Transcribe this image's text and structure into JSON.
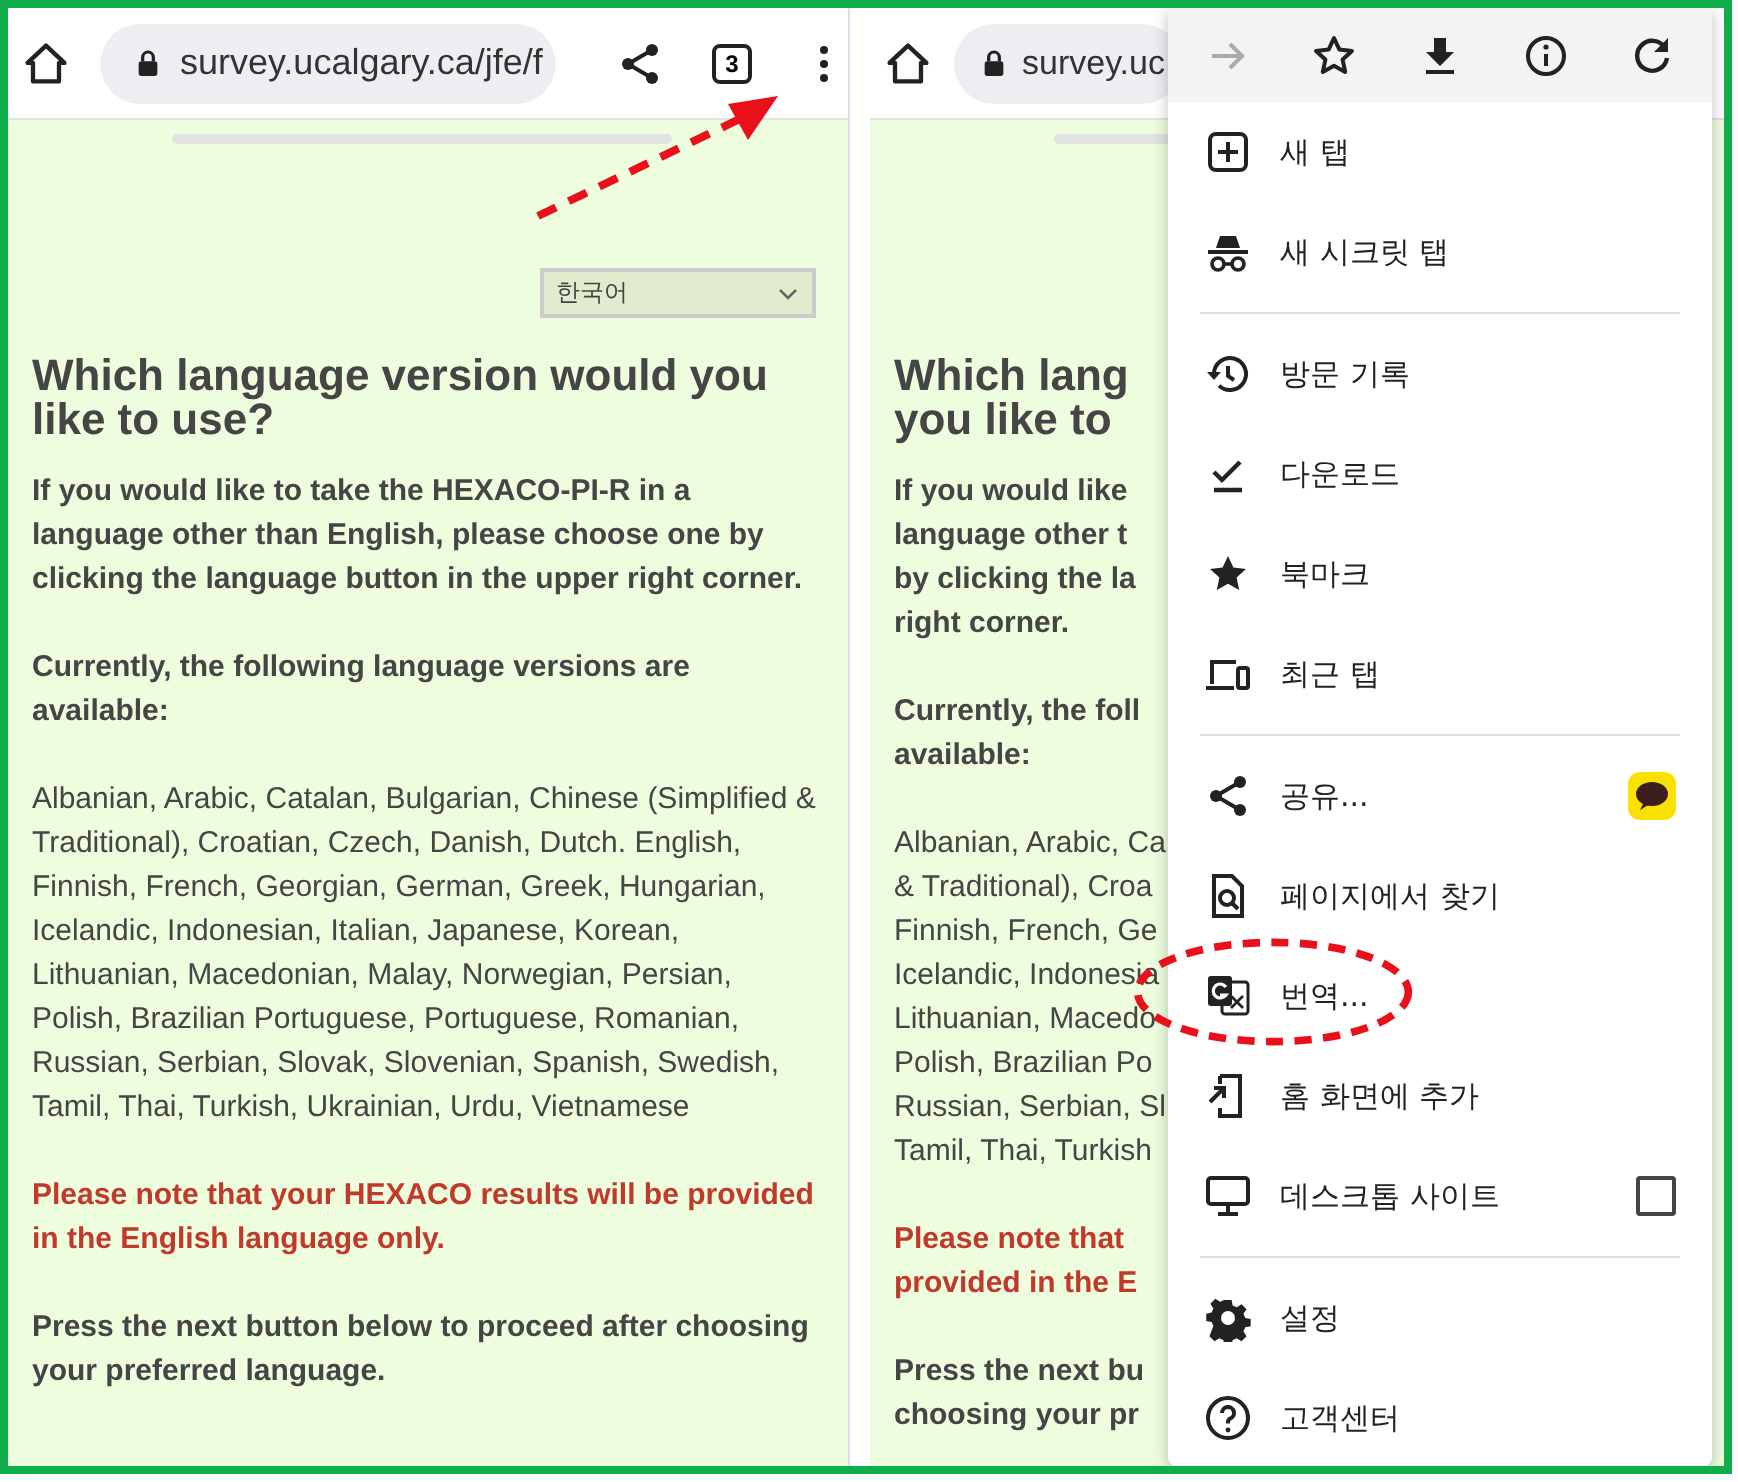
{
  "left_screen": {
    "toolbar": {
      "url": "survey.ucalgary.ca/jfe/f",
      "tab_count": "3"
    },
    "page": {
      "language_select": {
        "value": "한국어"
      },
      "heading": "Which language version would you like to use?",
      "paragraphs": [
        {
          "kind": "bold",
          "text": "If you would like to take the HEXACO-PI-R in a language other than English, please choose one by clicking the language button in the upper right corner."
        },
        {
          "kind": "bold",
          "text": "Currently, the following language versions are available:"
        },
        {
          "kind": "plain",
          "text": "Albanian, Arabic, Catalan, Bulgarian, Chinese (Simplified & Traditional), Croatian, Czech, Danish, Dutch. English, Finnish, French, Georgian, German, Greek, Hungarian, Icelandic, Indonesian, Italian, Japanese, Korean, Lithuanian, Macedonian, Malay, Norwegian, Persian, Polish, Brazilian Portuguese, Portuguese, Romanian, Russian, Serbian, Slovak, Slovenian, Spanish, Swedish, Tamil, Thai, Turkish, Ukrainian, Urdu, Vietnamese"
        },
        {
          "kind": "warning",
          "text": "Please note that your HEXACO results will be provided in the English language only."
        },
        {
          "kind": "bold",
          "text": "Press the next button below to proceed after choosing your preferred language."
        }
      ]
    }
  },
  "right_screen": {
    "toolbar": {
      "url": "survey.uc"
    },
    "page": {
      "heading_lines": [
        "Which lang",
        "you like to"
      ],
      "paragraphs": [
        {
          "kind": "bold",
          "lines": [
            "If you would like",
            "language other t",
            "by clicking the la",
            "right corner."
          ]
        },
        {
          "kind": "bold",
          "lines": [
            "Currently, the foll",
            "available:"
          ]
        },
        {
          "kind": "plain",
          "lines": [
            "Albanian, Arabic, Ca",
            "& Traditional), Croa",
            "Finnish, French, Ge",
            "Icelandic, Indonesia",
            "Lithuanian, Macedo",
            "Polish, Brazilian Po",
            "Russian, Serbian, Sl",
            "Tamil, Thai, Turkish"
          ]
        },
        {
          "kind": "warning",
          "lines": [
            "Please note that",
            "provided in the E"
          ]
        },
        {
          "kind": "bold",
          "lines": [
            "Press the next bu",
            "choosing your pr"
          ]
        }
      ]
    },
    "menu": {
      "top_actions": [
        {
          "kind": "forward",
          "disabled": true
        },
        {
          "kind": "star",
          "disabled": false
        },
        {
          "kind": "download",
          "disabled": false
        },
        {
          "kind": "info",
          "disabled": false
        },
        {
          "kind": "refresh",
          "disabled": false
        }
      ],
      "sections": [
        [
          {
            "kind": "new-tab",
            "label": "새 탭"
          },
          {
            "kind": "incognito",
            "label": "새 시크릿 탭"
          }
        ],
        [
          {
            "kind": "history",
            "label": "방문 기록"
          },
          {
            "kind": "downloads",
            "label": "다운로드"
          },
          {
            "kind": "bookmarks",
            "label": "북마크"
          },
          {
            "kind": "recent-tabs",
            "label": "최근 탭"
          }
        ],
        [
          {
            "kind": "share",
            "label": "공유...",
            "accessory": {
              "kind": "app-badge"
            }
          },
          {
            "kind": "find",
            "label": "페이지에서 찾기"
          },
          {
            "kind": "translate",
            "label": "번역..."
          },
          {
            "kind": "add-home",
            "label": "홈 화면에 추가"
          },
          {
            "kind": "desktop",
            "label": "데스크톱 사이트",
            "accessory": {
              "kind": "checkbox",
              "checked": false
            }
          }
        ],
        [
          {
            "kind": "settings",
            "label": "설정"
          },
          {
            "kind": "help",
            "label": "고객센터"
          }
        ]
      ]
    }
  }
}
